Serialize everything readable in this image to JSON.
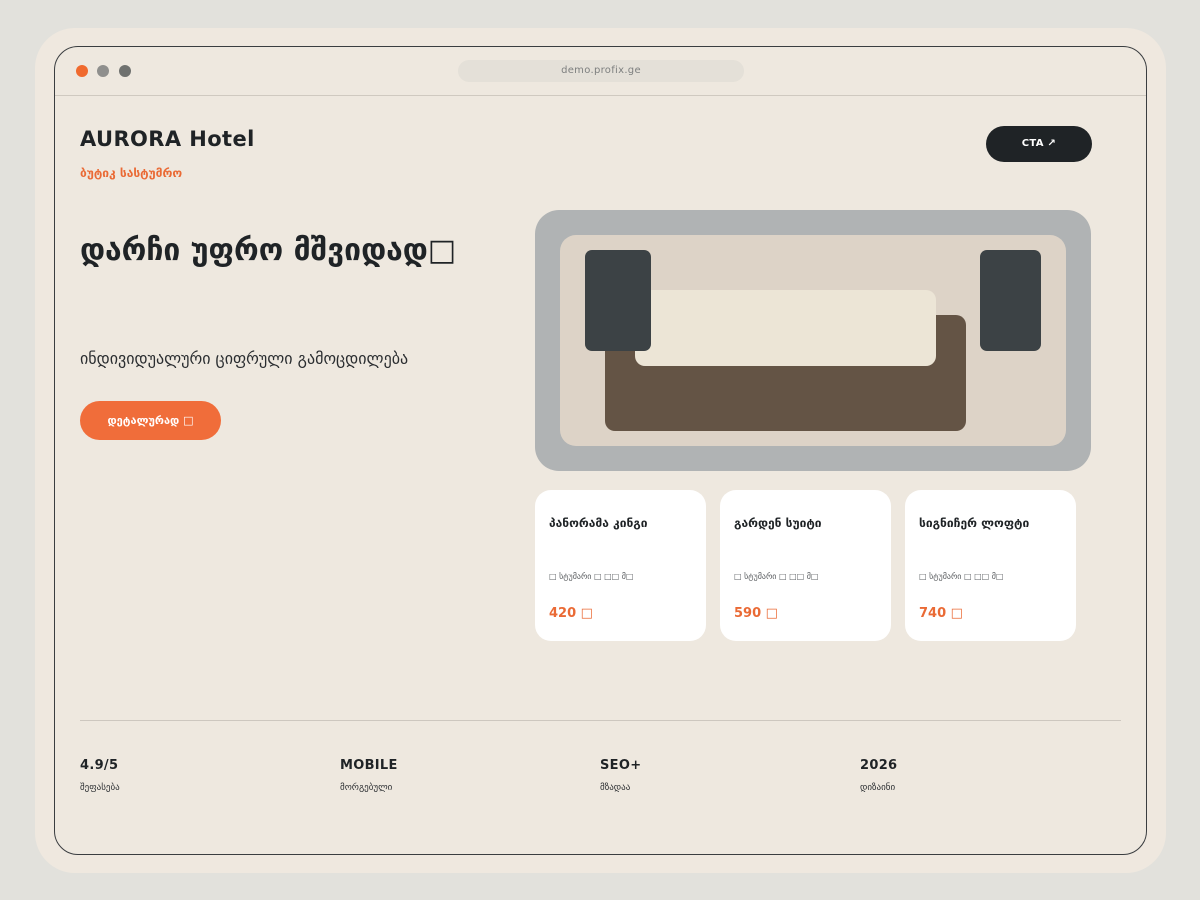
{
  "browser": {
    "url": "demo.profix.ge",
    "dot_colors": [
      "#f06a2e",
      "#8f8f8d",
      "#6f716f"
    ]
  },
  "header": {
    "brand": "AURORA Hotel",
    "brand_subtitle": "ბუტიკ სასტუმრო",
    "cta_label": "CTA  ↗"
  },
  "hero": {
    "title": "დარჩი უფრო მშვიდად",
    "title_suffix_glyph": "tofu",
    "subtitle": "ინდივიდუალური ციფრული გამოცდილება",
    "button_label": "დეტალურად",
    "button_icon": "tofu"
  },
  "cards": [
    {
      "title": "პანორამა კინგი",
      "meta": "□ სტუმარი □ □□ მ□",
      "price": "420 □"
    },
    {
      "title": "გარდენ სუიტი",
      "meta": "□ სტუმარი □ □□ მ□",
      "price": "590 □"
    },
    {
      "title": "სიგნიჩერ ლოფტი",
      "meta": "□ სტუმარი □ □□ მ□",
      "price": "740 □"
    }
  ],
  "stats": [
    {
      "value": "4.9/5",
      "label": "შეფასება"
    },
    {
      "value": "MOBILE",
      "label": "მორგებული"
    },
    {
      "value": "SEO+",
      "label": "მზადაა"
    },
    {
      "value": "2026",
      "label": "დიზაინი"
    }
  ],
  "colors": {
    "accent": "#f06d3a",
    "dark": "#1f2326",
    "background": "#eee8df"
  }
}
